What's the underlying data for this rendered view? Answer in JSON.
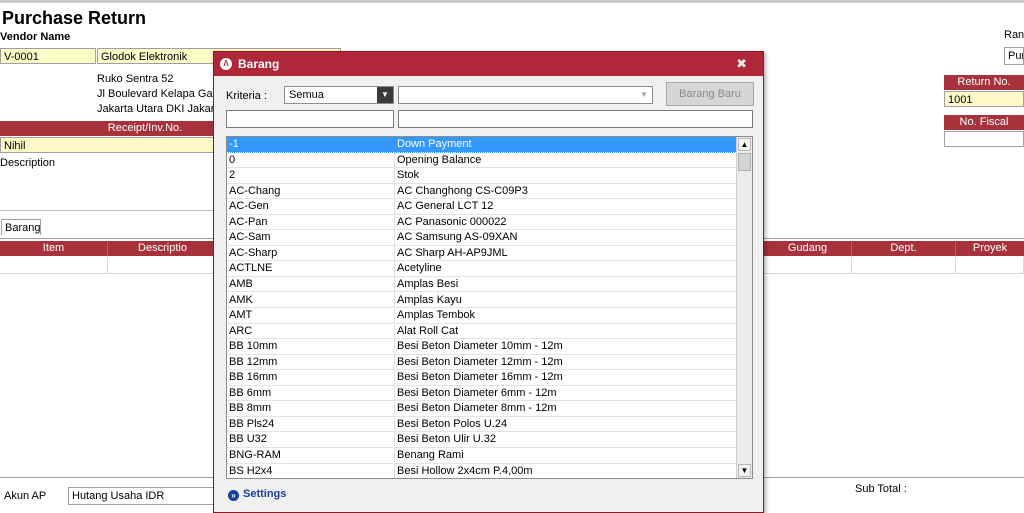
{
  "page": {
    "title": "Purchase Return",
    "vendor_label": "Vendor Name",
    "vendor_code": "V-0001",
    "vendor_name": "Glodok Elektronik",
    "address": [
      "Ruko Sentra 52",
      "Jl Boulevard Kelapa Gad",
      "Jakarta Utara DKI Jakart"
    ],
    "receipt_header": "Receipt/Inv.No.",
    "receipt_value": "Nihil",
    "description_label": "Description",
    "right_label_ran": "Ran",
    "right_field_pur": "Pur",
    "return_no_header": "Return No.",
    "return_no_value": "1001",
    "no_fiscal_header": "No. Fiscal",
    "tab_barang": "Barang",
    "grid_headers": [
      "Item",
      "Descriptio",
      "Gudang",
      "Dept.",
      "Proyek"
    ],
    "akun_ap_label": "Akun AP",
    "akun_ap_value": "Hutang Usaha IDR",
    "sub_total_label": "Sub Total :"
  },
  "dialog": {
    "title": "Barang",
    "close_glyph": "✖",
    "kriteria_label": "Kriteria :",
    "kriteria_value": "Semua",
    "barang_baru_label": "Barang Baru",
    "settings_label": "Settings",
    "items": [
      {
        "code": "-1",
        "name": "Down Payment"
      },
      {
        "code": "0",
        "name": "Opening Balance"
      },
      {
        "code": "2",
        "name": "Stok"
      },
      {
        "code": "AC-Chang",
        "name": "AC Changhong CS-C09P3"
      },
      {
        "code": "AC-Gen",
        "name": "AC General LCT 12"
      },
      {
        "code": "AC-Pan",
        "name": "AC Panasonic 000022"
      },
      {
        "code": "AC-Sam",
        "name": "AC Samsung AS-09XAN"
      },
      {
        "code": "AC-Sharp",
        "name": "AC Sharp AH-AP9JML"
      },
      {
        "code": "ACTLNE",
        "name": "Acetyline"
      },
      {
        "code": "AMB",
        "name": "Amplas Besi"
      },
      {
        "code": "AMK",
        "name": "Amplas Kayu"
      },
      {
        "code": "AMT",
        "name": "Amplas Tembok"
      },
      {
        "code": "ARC",
        "name": "Alat Roll Cat"
      },
      {
        "code": "BB 10mm",
        "name": "Besi Beton Diameter 10mm - 12m"
      },
      {
        "code": "BB 12mm",
        "name": "Besi Beton Diameter 12mm - 12m"
      },
      {
        "code": "BB 16mm",
        "name": "Besi Beton Diameter 16mm - 12m"
      },
      {
        "code": "BB 6mm",
        "name": "Besi Beton Diameter 6mm - 12m"
      },
      {
        "code": "BB 8mm",
        "name": "Besi Beton Diameter 8mm - 12m"
      },
      {
        "code": "BB Pls24",
        "name": "Besi Beton Polos U.24"
      },
      {
        "code": "BB U32",
        "name": "Besi Beton Ulir U.32"
      },
      {
        "code": "BNG-RAM",
        "name": "Benang Rami"
      },
      {
        "code": "BS H2x4",
        "name": "Besi Hollow 2x4cm P.4,00m"
      }
    ]
  }
}
